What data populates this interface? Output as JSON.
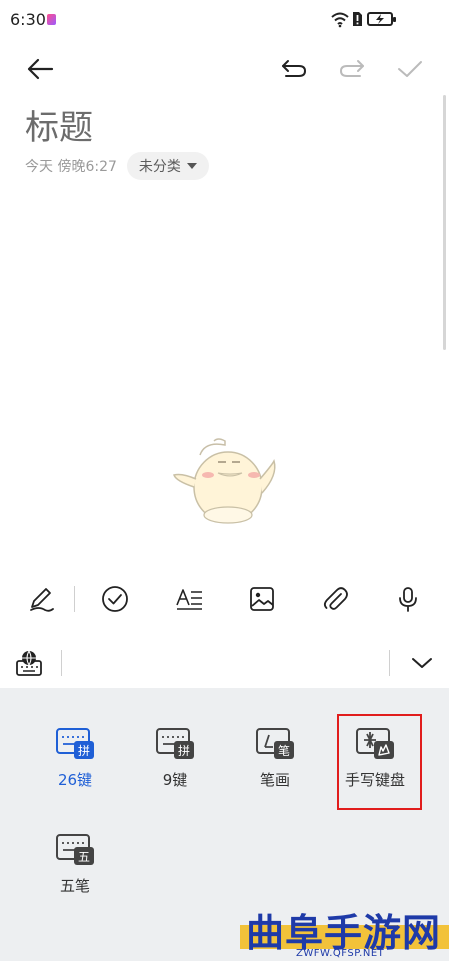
{
  "status_bar": {
    "time": "6:30"
  },
  "header": {
    "back_icon": "arrow-left-icon",
    "undo_icon": "undo-icon",
    "redo_icon": "redo-icon",
    "confirm_icon": "check-icon"
  },
  "note": {
    "title": "标题",
    "date": "今天 傍晚6:27",
    "category": "未分类"
  },
  "edit_tools": [
    "handwriting-pen-icon",
    "checklist-icon",
    "text-style-icon",
    "image-icon",
    "attachment-icon",
    "microphone-icon"
  ],
  "keyboard": {
    "options": [
      {
        "label": "26键",
        "badge": "拼",
        "active": true
      },
      {
        "label": "9键",
        "badge": "拼",
        "active": false
      },
      {
        "label": "笔画",
        "badge": "笔",
        "active": false
      },
      {
        "label": "手写键盘",
        "badge": "",
        "active": false
      },
      {
        "label": "五笔",
        "badge": "五",
        "active": false
      }
    ]
  },
  "watermark": {
    "title": "曲阜手游网",
    "url": "ZWFW.QFSP.NET"
  },
  "colors": {
    "accent": "#1f5fd6",
    "highlight": "#e11c1c",
    "panel": "#edeff1"
  }
}
